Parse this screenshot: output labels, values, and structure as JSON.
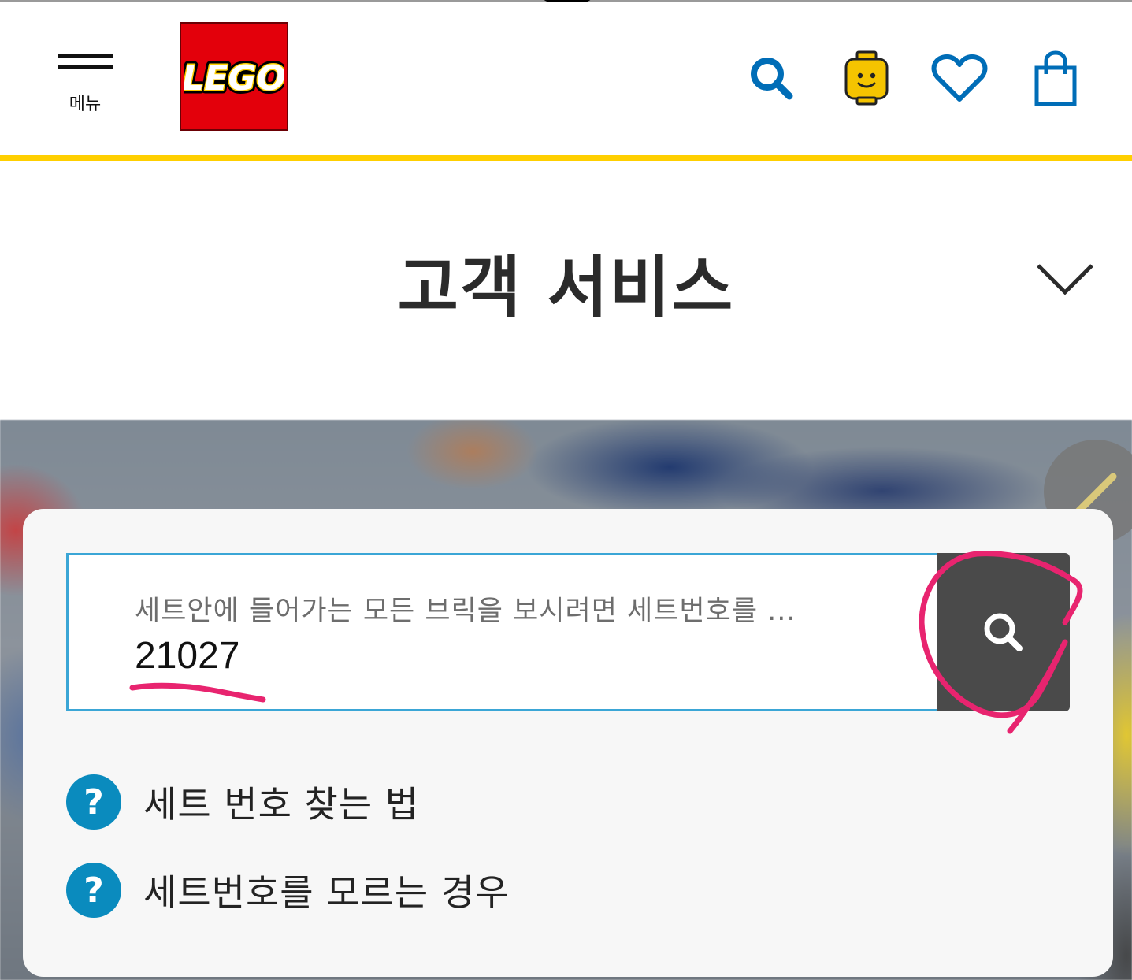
{
  "header": {
    "menu_label": "메뉴",
    "logo_text": "LEGO",
    "icons": [
      "search-icon",
      "vip-minifig-icon",
      "heart-icon",
      "shopping-bag-icon"
    ],
    "accent_color": "#ffcf00",
    "icon_color": "#006db7"
  },
  "page": {
    "title": "고객 서비스"
  },
  "search": {
    "placeholder": "세트안에 들어가는 모든 브릭을 보시려면 세트번호를 ...",
    "value": "21027"
  },
  "help_links": [
    {
      "icon": "?",
      "label": "세트 번호 찾는 법"
    },
    {
      "icon": "?",
      "label": "세트번호를 모르는 경우"
    }
  ],
  "colors": {
    "help_icon": "#0a8bbe",
    "search_button": "#4a4a4a",
    "input_border": "#3ba6d6",
    "annotation": "#e8246f"
  }
}
